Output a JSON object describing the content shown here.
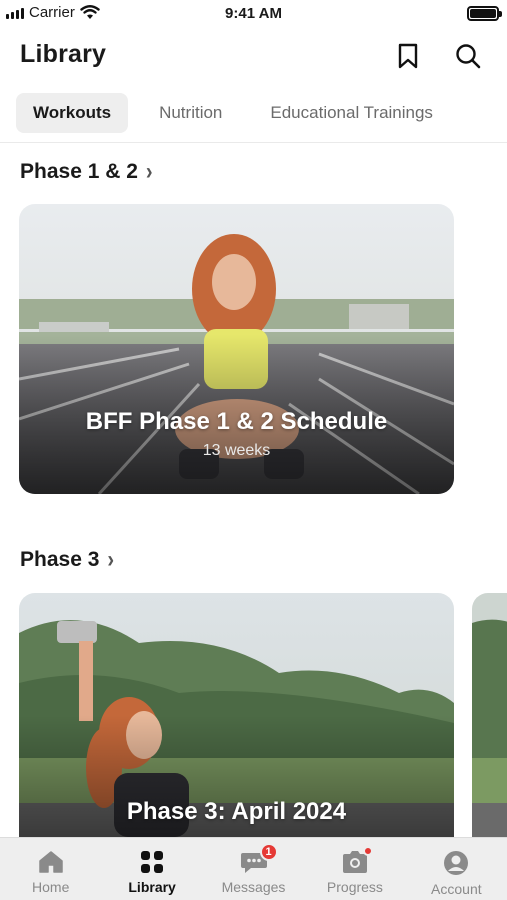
{
  "status_bar": {
    "carrier": "Carrier",
    "time": "9:41 AM"
  },
  "header": {
    "title": "Library",
    "bookmark_icon": "bookmark-icon",
    "search_icon": "search-icon"
  },
  "tabs": [
    {
      "label": "Workouts",
      "active": true
    },
    {
      "label": "Nutrition",
      "active": false
    },
    {
      "label": "Educational Trainings",
      "active": false
    }
  ],
  "sections": [
    {
      "title": "Phase 1 & 2",
      "cards": [
        {
          "title": "BFF Phase 1 & 2 Schedule",
          "subtitle": "13 weeks"
        }
      ]
    },
    {
      "title": "Phase 3",
      "cards": [
        {
          "title": "Phase 3: April 2024"
        }
      ]
    }
  ],
  "bottom_nav": [
    {
      "label": "Home",
      "icon": "home-icon",
      "active": false
    },
    {
      "label": "Library",
      "icon": "grid-icon",
      "active": true
    },
    {
      "label": "Messages",
      "icon": "chat-icon",
      "active": false,
      "badge": "1"
    },
    {
      "label": "Progress",
      "icon": "camera-icon",
      "active": false,
      "dot": true
    },
    {
      "label": "Account",
      "icon": "account-icon",
      "active": false
    }
  ],
  "colors": {
    "accent_red": "#e53935",
    "tab_active_bg": "#eeeeee",
    "text": "#1a1a1a"
  }
}
